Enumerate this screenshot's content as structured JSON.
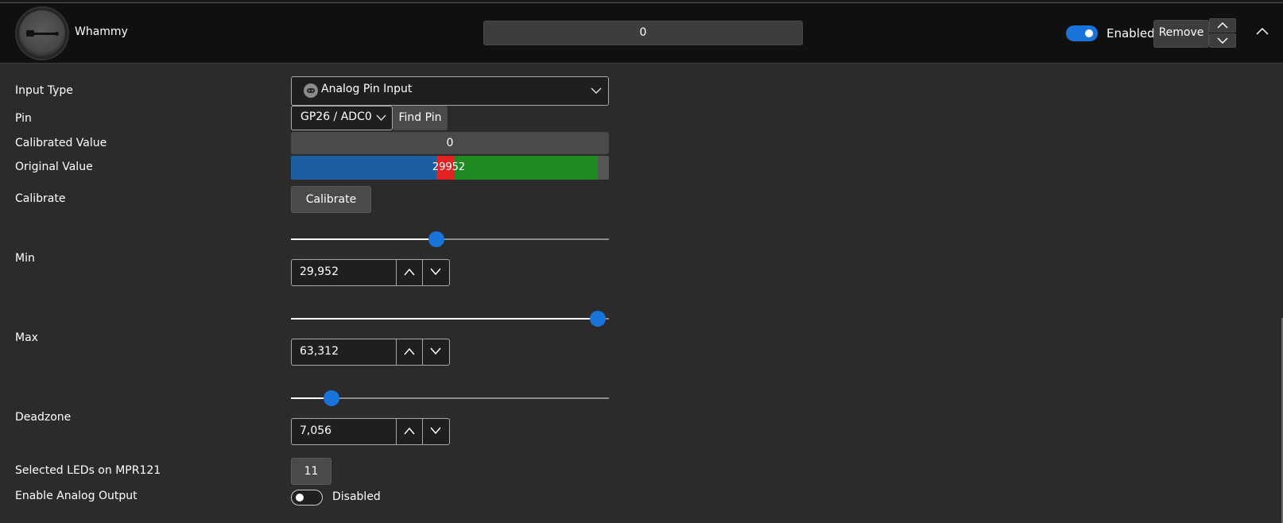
{
  "header": {
    "title": "Whammy",
    "value": "0",
    "enabled_label": "Enabled",
    "enabled": true,
    "remove_label": "Remove",
    "accent_color": "#1a73d9",
    "icons": [
      "whammy-logo-icon",
      "chevron-up-icon",
      "chevron-down-icon",
      "collapse-chevron-icon"
    ]
  },
  "form": {
    "input_type": {
      "label": "Input Type",
      "value": "Analog Pin Input",
      "icon": "gamepad-icon"
    },
    "pin": {
      "label": "Pin",
      "value": "GP26 / ADC0",
      "find_label": "Find Pin"
    },
    "calibrated": {
      "label": "Calibrated Value",
      "value": "0"
    },
    "original": {
      "label": "Original Value",
      "value": "29952",
      "raw": 29952,
      "range_max": 65535,
      "min": 29952,
      "deadzone_end": 33588,
      "max": 63312,
      "colors": {
        "below_min": "#1b5fa0",
        "deadzone": "#e22222",
        "active": "#1f8a22"
      }
    },
    "calibrate": {
      "label": "Calibrate",
      "button": "Calibrate"
    },
    "min": {
      "label": "Min",
      "value": "29,952",
      "slider_fraction": 0.457
    },
    "max": {
      "label": "Max",
      "value": "63,312",
      "slider_fraction": 0.966
    },
    "deadzone": {
      "label": "Deadzone",
      "value": "7,056",
      "slider_fraction": 0.128
    },
    "leds": {
      "label": "Selected LEDs on MPR121",
      "value": "11"
    },
    "analog_output": {
      "label": "Enable Analog Output",
      "state": "Disabled",
      "enabled": false
    }
  }
}
